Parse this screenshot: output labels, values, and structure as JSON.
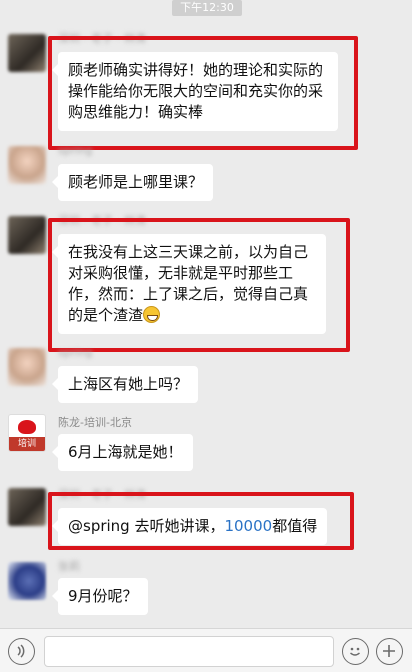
{
  "status_bar": {
    "time": "下午12:30"
  },
  "messages": [
    {
      "sender": "深圳 - 老子 - 林涛",
      "text": "顾老师确实讲得好！她的理论和实际的操作能给你无限大的空间和充实你的采购思维能力！确实棒",
      "highlighted": true
    },
    {
      "sender": "spring",
      "text": "顾老师是上哪里课？",
      "highlighted": false
    },
    {
      "sender": "深圳 - 老子 - 林涛",
      "text": "在我没有上这三天课之前，以为自己对采购很懂，无非就是平时那些工作，然而：上了课之后，觉得自己真的是个渣渣",
      "emoji": "grin-emoji",
      "highlighted": true
    },
    {
      "sender": "spring",
      "text": "上海区有她上吗？",
      "highlighted": false
    },
    {
      "sender": "陈龙-培训-北京",
      "avatar_text": "培训",
      "text": "6月上海就是她！",
      "highlighted": false
    },
    {
      "sender": "深圳 - 老子 - 林涛",
      "text_prefix": "@spring 去听她讲课，",
      "text_number": "10000",
      "text_suffix": "都值得",
      "highlighted": true
    },
    {
      "sender": "张莉",
      "text": "9月份呢？",
      "highlighted": false
    }
  ],
  "colors": {
    "highlight": "#d9141b",
    "link_blue": "#2a72c5",
    "background": "#ebebeb"
  },
  "input_bar": {
    "left_icon": "voice-icon",
    "right_icons": [
      "emoji-icon",
      "plus-icon"
    ]
  }
}
